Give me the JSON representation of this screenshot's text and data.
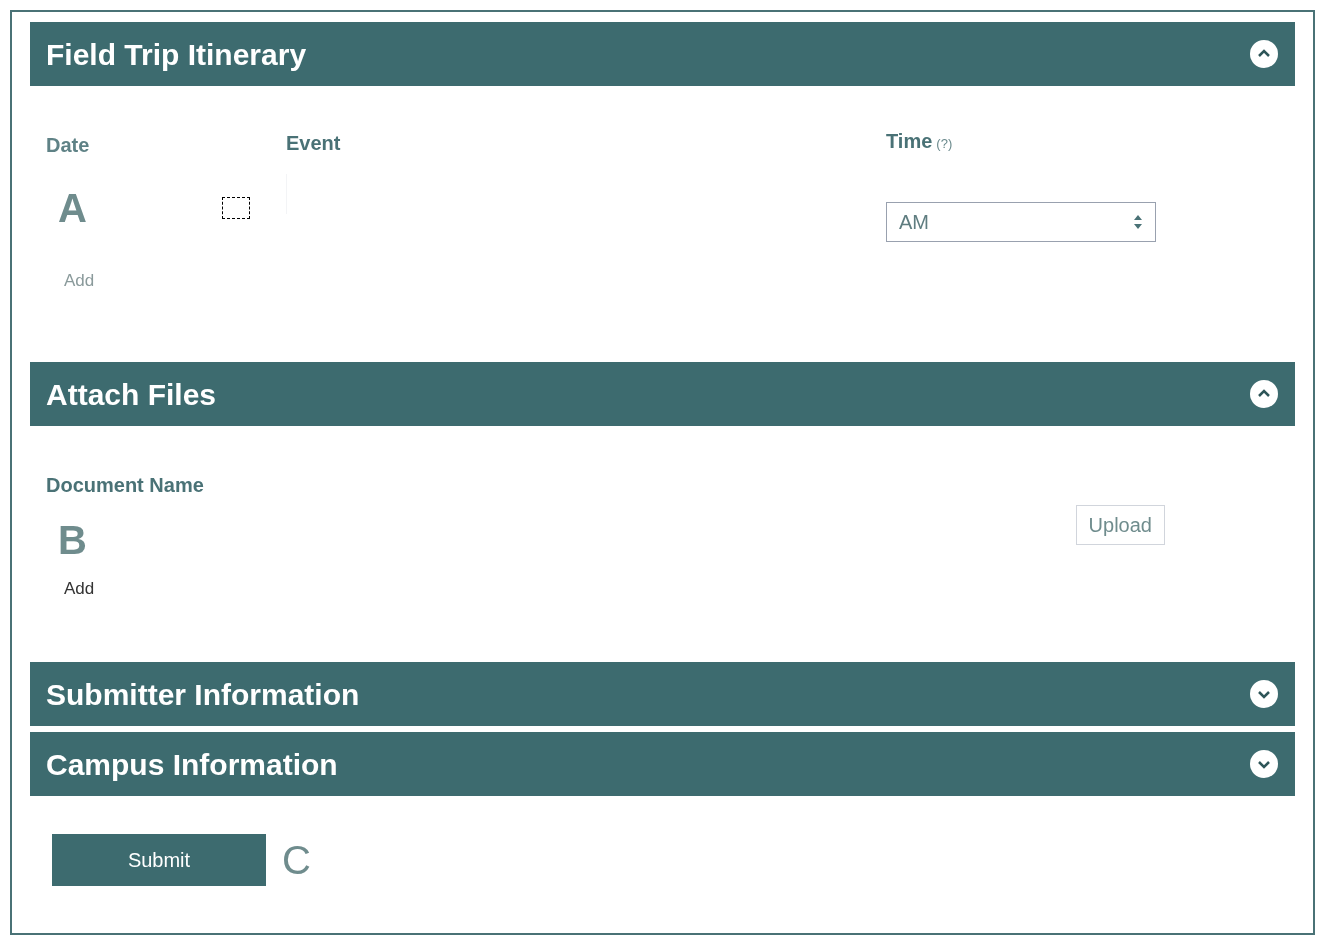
{
  "sections": [
    {
      "kind": "itinerary",
      "title": "Field Trip Itinerary",
      "expanded": true,
      "columns": [
        "Date",
        "Event"
      ],
      "time_label": "Time",
      "time_hint": "(?)",
      "marker": "A",
      "period": "AM",
      "add": "Add"
    },
    {
      "kind": "files",
      "title": "Attach Files",
      "expanded": true,
      "column": "Document Name",
      "marker": "B",
      "upload": "Upload",
      "add": "Add"
    },
    {
      "title": "Submitter Information",
      "expanded": false
    },
    {
      "title": "Campus Information",
      "expanded": false
    }
  ],
  "submit": "Submit",
  "marker": "C"
}
